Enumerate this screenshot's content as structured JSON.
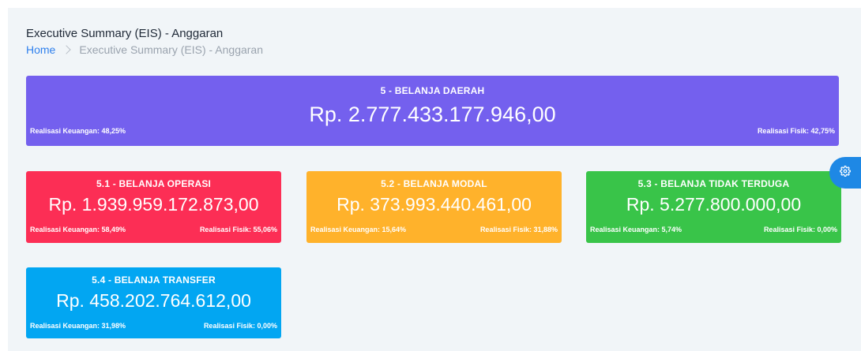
{
  "header": {
    "title": "Executive Summary (EIS) - Anggaran",
    "breadcrumb": {
      "home": "Home",
      "current": "Executive Summary (EIS) - Anggaran"
    }
  },
  "summary": {
    "title": "5 - BELANJA DAERAH",
    "amount": "Rp. 2.777.433.177.946,00",
    "realisasi_keuangan": "Realisasi Keuangan: 48,25%",
    "realisasi_fisik": "Realisasi Fisik: 42,75%",
    "color": "#7460ee"
  },
  "cards": [
    {
      "title": "5.1 - BELANJA OPERASI",
      "amount": "Rp. 1.939.959.172.873,00",
      "realisasi_keuangan": "Realisasi Keuangan: 58,49%",
      "realisasi_fisik": "Realisasi Fisik: 55,06%",
      "color": "#fc2e55"
    },
    {
      "title": "5.2 - BELANJA MODAL",
      "amount": "Rp. 373.993.440.461,00",
      "realisasi_keuangan": "Realisasi Keuangan: 15,64%",
      "realisasi_fisik": "Realisasi Fisik: 31,88%",
      "color": "#ffb22b"
    },
    {
      "title": "5.3 - BELANJA TIDAK TERDUGA",
      "amount": "Rp. 5.277.800.000,00",
      "realisasi_keuangan": "Realisasi Keuangan: 5,74%",
      "realisasi_fisik": "Realisasi Fisik: 0,00%",
      "color": "#39c449"
    },
    {
      "title": "5.4 - BELANJA TRANSFER",
      "amount": "Rp. 458.202.764.612,00",
      "realisasi_keuangan": "Realisasi Keuangan: 31,98%",
      "realisasi_fisik": "Realisasi Fisik: 0,00%",
      "color": "#02a6f2"
    }
  ],
  "settings": {
    "icon": "gear-icon",
    "color": "#1e88e5"
  }
}
